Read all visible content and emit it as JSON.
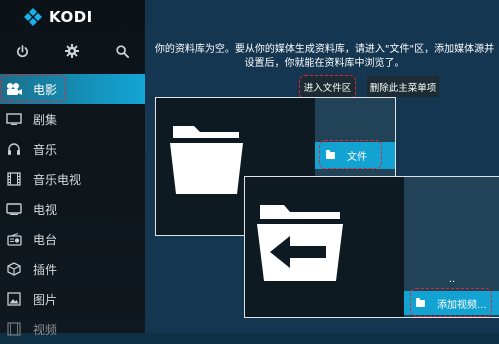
{
  "app": {
    "name": "KODI",
    "colors": {
      "accent": "#12a6d6",
      "sidebar": "#0b1218",
      "main": "#143650",
      "highlight": "#e2262f"
    }
  },
  "toolbar": {
    "icons": [
      "power-icon",
      "gear-icon",
      "search-icon"
    ]
  },
  "sidebar": {
    "items": [
      {
        "label": "电影",
        "icon": "movie-icon",
        "active": true
      },
      {
        "label": "剧集",
        "icon": "tv-screen-icon"
      },
      {
        "label": "音乐",
        "icon": "headphones-icon"
      },
      {
        "label": "音乐电视",
        "icon": "film-strip-icon"
      },
      {
        "label": "电视",
        "icon": "tv-icon"
      },
      {
        "label": "电台",
        "icon": "radio-icon"
      },
      {
        "label": "插件",
        "icon": "box-icon"
      },
      {
        "label": "图片",
        "icon": "picture-icon"
      },
      {
        "label": "视频",
        "icon": "video-icon"
      }
    ]
  },
  "main": {
    "message": "你的资料库为空。要从你的媒体生成资料库，请进入\"文件\"区，添加媒体源并设置后，你就能在资料库中浏览了。",
    "buttons": {
      "enter_files": "进入文件区",
      "remove_item": "删除此主菜单项"
    },
    "panel1": {
      "row_label": "文件"
    },
    "panel2": {
      "parent_label": "..",
      "add_label": "添加视频..."
    }
  }
}
